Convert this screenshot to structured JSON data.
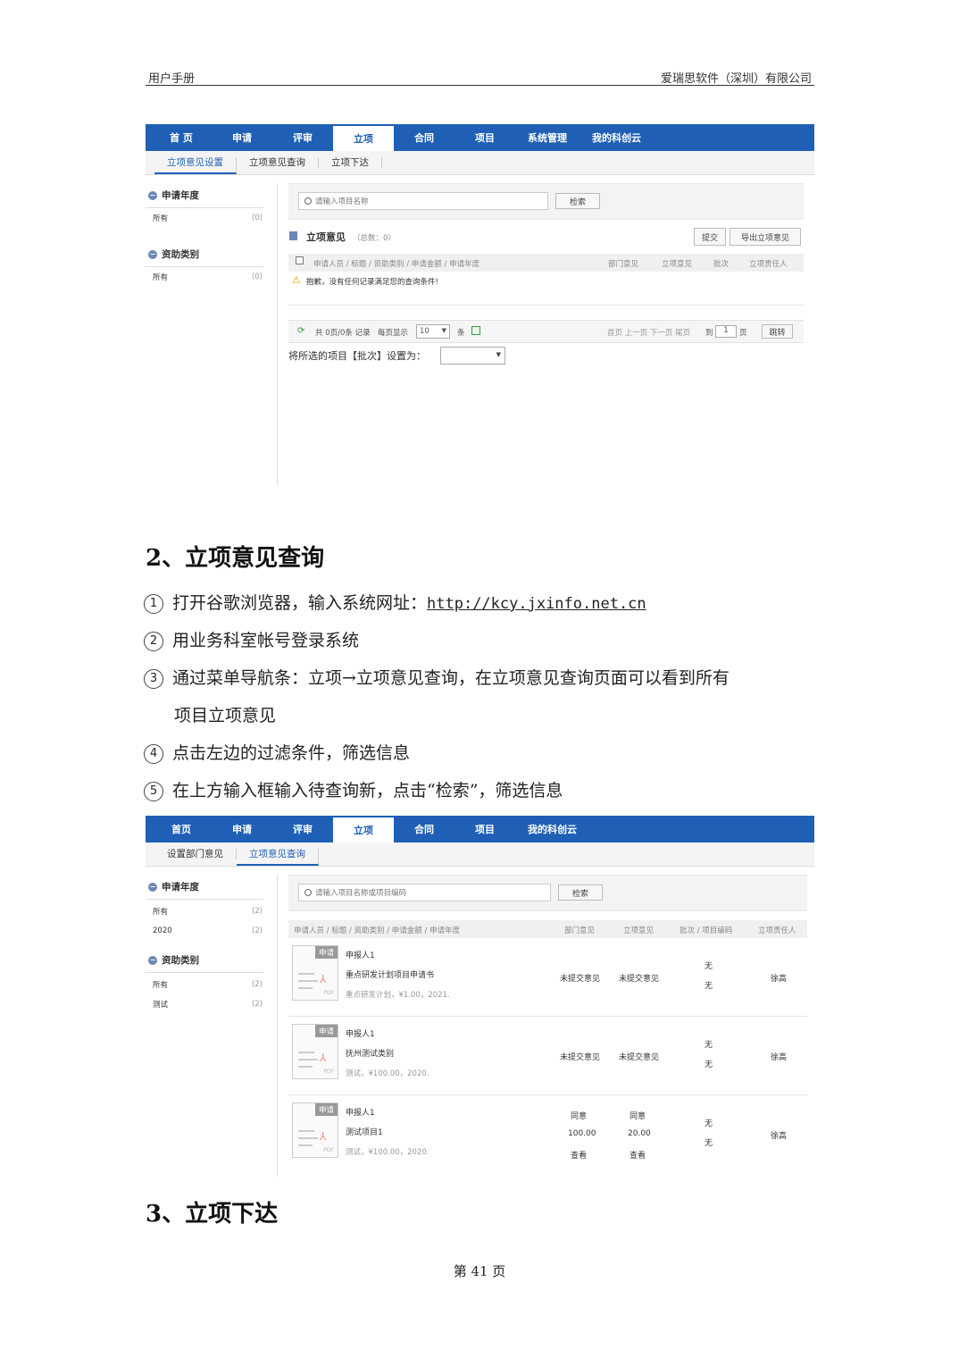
{
  "header": {
    "left": "用户手册",
    "right": "爱瑞思软件（深圳）有限公司"
  },
  "shot1": {
    "nav": [
      "首 页",
      "申请",
      "评审",
      "立项",
      "合同",
      "项目",
      "系统管理",
      "我的科创云"
    ],
    "sub": [
      "立项意见设置",
      "立项意见查询",
      "立项下达"
    ],
    "side": {
      "g1": "申请年度",
      "g1_rows": [
        {
          "l": "所有",
          "c": "(0)"
        }
      ],
      "g2": "资助类别",
      "g2_rows": [
        {
          "l": "所有",
          "c": "(0)"
        }
      ]
    },
    "search_placeholder": "请输入项目名称",
    "search_btn": "检索",
    "section_title": "立项意见",
    "section_count": "（总数：0）",
    "btn_submit": "提交",
    "btn_export": "导出立项意见",
    "cols": [
      "申请人员 / 标题 / 资助类别 / 申请金额 / 申请年度",
      "部门意见",
      "立项意见",
      "批次",
      "立项责任人"
    ],
    "empty_msg": "抱歉，没有任何记录满足您的查询条件!",
    "pager": {
      "total": "共 0页/0条 记录",
      "per": "每页显示",
      "per_val": "10",
      "unit": "条",
      "nav": "首页 上一页 下一页 尾页",
      "goto": "到",
      "page": "1",
      "page_unit": "页",
      "jump": "跳转"
    },
    "batch_label": "将所选的项目【批次】设置为："
  },
  "section2": {
    "title": "2、立项意见查询",
    "steps": [
      {
        "n": "1",
        "t": "打开谷歌浏览器，输入系统网址：",
        "link": "http://kcy.jxinfo.net.cn"
      },
      {
        "n": "2",
        "t": "用业务科室帐号登录系统"
      },
      {
        "n": "3",
        "t": "通过菜单导航条：立项→立项意见查询，在立项意见查询页面可以看到所有",
        "t2": "项目立项意见"
      },
      {
        "n": "4",
        "t": "点击左边的过滤条件，筛选信息"
      },
      {
        "n": "5",
        "t": "在上方输入框输入待查询新，点击“检索”，筛选信息"
      }
    ]
  },
  "shot2": {
    "nav": [
      "首页",
      "申请",
      "评审",
      "立项",
      "合同",
      "项目",
      "我的科创云"
    ],
    "sub": [
      "设置部门意见",
      "立项意见查询"
    ],
    "side": {
      "g1": "申请年度",
      "g1_rows": [
        {
          "l": "所有",
          "c": "(2)"
        },
        {
          "l": "2020",
          "c": "(2)"
        }
      ],
      "g2": "资助类别",
      "g2_rows": [
        {
          "l": "所有",
          "c": "(2)"
        },
        {
          "l": "测试",
          "c": "(2)"
        }
      ]
    },
    "search_placeholder": "请输入项目名称或项目编码",
    "search_btn": "检索",
    "cols": [
      "申请人员 / 标题 / 资助类别 / 申请金额 / 申请年度",
      "部门意见",
      "立项意见",
      "批次 / 项目编码",
      "立项责任人"
    ],
    "rows": [
      {
        "tag": "申请",
        "applicant": "申报人1",
        "title": "重点研发计划项目申请书",
        "meta": "重点研发计划，¥1.00，2021.",
        "dept": [
          "未提交意见"
        ],
        "lx": [
          "未提交意见"
        ],
        "batch": "无",
        "code": "无",
        "owner": "徐高"
      },
      {
        "tag": "申请",
        "applicant": "申报人1",
        "title": "抚州测试类别",
        "meta": "测试，¥100.00，2020.",
        "dept": [
          "未提交意见"
        ],
        "lx": [
          "未提交意见"
        ],
        "batch": "无",
        "code": "无",
        "owner": "徐高"
      },
      {
        "tag": "申请",
        "applicant": "申报人1",
        "title": "测试项目1",
        "meta": "测试，¥100.00，2020.",
        "dept": [
          "同意",
          "100.00",
          "查看"
        ],
        "lx": [
          "同意",
          "20.00",
          "查看"
        ],
        "batch": "无",
        "code": "无",
        "owner": "徐高"
      }
    ]
  },
  "section3": {
    "title": "3、立项下达"
  },
  "footer": "第 41 页"
}
